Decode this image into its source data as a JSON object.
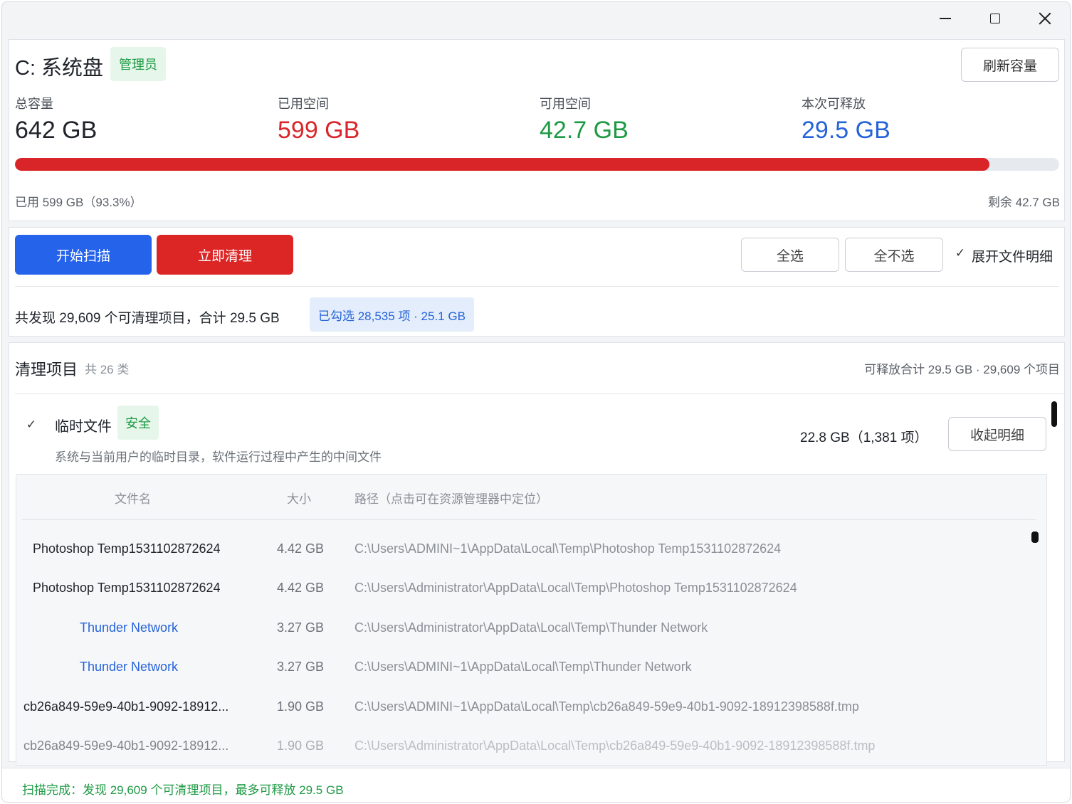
{
  "disk": {
    "title": "C: 系统盘",
    "role_badge": "管理员",
    "refresh_label": "刷新容量",
    "stats": [
      {
        "label": "总容量",
        "value": "642 GB",
        "color": "#1f2329"
      },
      {
        "label": "已用空间",
        "value": "599 GB",
        "color": "#d9262b"
      },
      {
        "label": "可用空间",
        "value": "42.7 GB",
        "color": "#1d9a43"
      },
      {
        "label": "本次可释放",
        "value": "29.5 GB",
        "color": "#2563d9"
      }
    ],
    "usage_fraction": 0.933,
    "used_text": "已用 599 GB（93.3%）",
    "remaining_text": "剩余 42.7 GB"
  },
  "actions": {
    "scan_label": "开始扫描",
    "clean_label": "立即清理",
    "select_all_label": "全选",
    "select_none_label": "全不选",
    "expand_check": "✓",
    "expand_label": "展开文件明细",
    "found_text": "共发现 29,609 个可清理项目，合计 29.5 GB",
    "selected_badge": "已勾选 28,535 项 · 25.1 GB"
  },
  "list": {
    "title": "清理项目",
    "count": "共 26 类",
    "total": "可释放合计 29.5 GB · 29,609 个项目",
    "category": {
      "check": "✓",
      "name": "临时文件",
      "badge": "安全",
      "description": "系统与当前用户的临时目录，软件运行过程中产生的中间文件",
      "size": "22.8 GB（1,381 项）",
      "collapse_label": "收起明细"
    },
    "columns": {
      "name": "文件名",
      "size": "大小",
      "path": "路径（点击可在资源管理器中定位）"
    },
    "rows": [
      {
        "name": "Photoshop Temp1531102872624",
        "size": "4.42 GB",
        "path": "C:\\Users\\ADMINI~1\\AppData\\Local\\Temp\\Photoshop Temp1531102872624"
      },
      {
        "name": "Photoshop Temp1531102872624",
        "size": "4.42 GB",
        "path": "C:\\Users\\Administrator\\AppData\\Local\\Temp\\Photoshop Temp1531102872624"
      },
      {
        "name": "Thunder Network",
        "size": "3.27 GB",
        "path": "C:\\Users\\Administrator\\AppData\\Local\\Temp\\Thunder Network"
      },
      {
        "name": "Thunder Network",
        "size": "3.27 GB",
        "path": "C:\\Users\\ADMINI~1\\AppData\\Local\\Temp\\Thunder Network"
      },
      {
        "name": "cb26a849-59e9-40b1-9092-18912...",
        "size": "1.90 GB",
        "path": "C:\\Users\\ADMINI~1\\AppData\\Local\\Temp\\cb26a849-59e9-40b1-9092-18912398588f.tmp"
      },
      {
        "name": "cb26a849-59e9-40b1-9092-18912...",
        "size": "1.90 GB",
        "path": "C:\\Users\\Administrator\\AppData\\Local\\Temp\\cb26a849-59e9-40b1-9092-18912398588f.tmp"
      }
    ]
  },
  "status": {
    "text": "扫描完成：发现 29,609 个可清理项目，最多可释放 29.5 GB"
  }
}
